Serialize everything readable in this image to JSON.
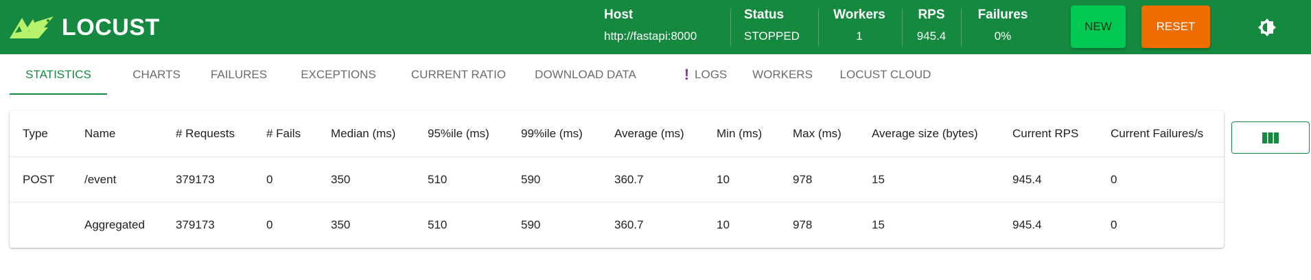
{
  "app": {
    "logo_text": "LOCUST"
  },
  "header": {
    "host": {
      "label": "Host",
      "value": "http://fastapi:8000"
    },
    "status": {
      "label": "Status",
      "value": "STOPPED"
    },
    "workers": {
      "label": "Workers",
      "value": "1"
    },
    "rps": {
      "label": "RPS",
      "value": "945.4"
    },
    "failures": {
      "label": "Failures",
      "value": "0%"
    },
    "new_label": "NEW",
    "reset_label": "RESET",
    "theme_icon": "brightness-icon"
  },
  "tabs": [
    {
      "label": "STATISTICS",
      "active": true
    },
    {
      "label": "CHARTS"
    },
    {
      "label": "FAILURES"
    },
    {
      "label": "EXCEPTIONS"
    },
    {
      "label": "CURRENT RATIO"
    },
    {
      "label": "DOWNLOAD DATA"
    },
    {
      "label": "LOGS",
      "alert_mark": "!"
    },
    {
      "label": "WORKERS"
    },
    {
      "label": "LOCUST CLOUD"
    }
  ],
  "table": {
    "headers": [
      "Type",
      "Name",
      "# Requests",
      "# Fails",
      "Median (ms)",
      "95%ile (ms)",
      "99%ile (ms)",
      "Average (ms)",
      "Min (ms)",
      "Max (ms)",
      "Average size (bytes)",
      "Current RPS",
      "Current Failures/s"
    ],
    "rows": [
      [
        "POST",
        "/event",
        "379173",
        "0",
        "350",
        "510",
        "590",
        "360.7",
        "10",
        "978",
        "15",
        "945.4",
        "0"
      ],
      [
        "",
        "Aggregated",
        "379173",
        "0",
        "350",
        "510",
        "590",
        "360.7",
        "10",
        "978",
        "15",
        "945.4",
        "0"
      ]
    ],
    "columns_button_icon": "view-columns-icon"
  },
  "colors": {
    "brand_green": "#15893f",
    "new_button": "#00c853",
    "reset_button": "#ef6c00",
    "logs_alert": "#9c27b0"
  }
}
